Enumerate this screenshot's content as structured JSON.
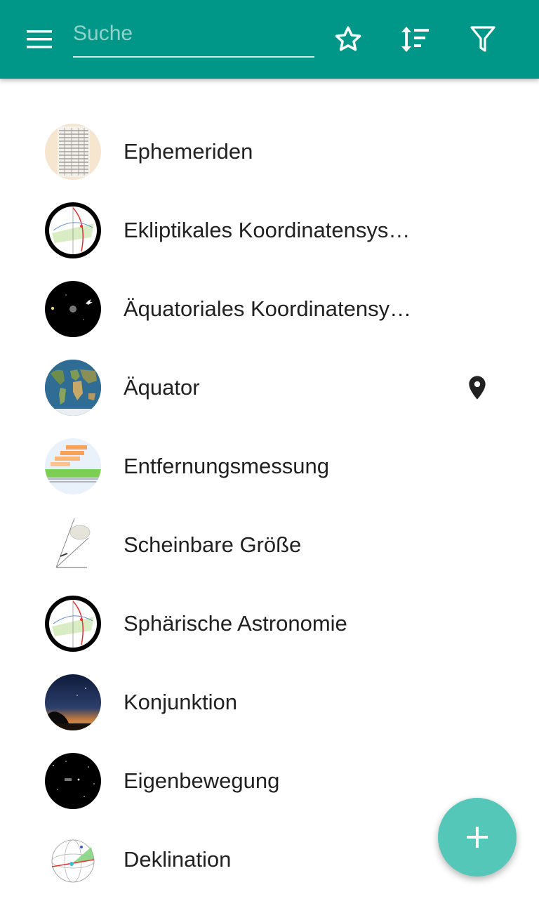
{
  "toolbar": {
    "search_placeholder": "Suche",
    "search_value": "",
    "icons": [
      "menu-icon",
      "star-outline-icon",
      "sort-icon",
      "filter-icon"
    ],
    "color": "#009688"
  },
  "items": [
    {
      "label": "Ephemeriden",
      "thumb": "ephemeris-table-thumbnail"
    },
    {
      "label": "Ekliptikales Koordinatensys…",
      "thumb": "celestial-sphere-thumbnail"
    },
    {
      "label": "Äquatoriales Koordinatensy…",
      "thumb": "night-sky-thumbnail"
    },
    {
      "label": "Äquator",
      "thumb": "world-map-thumbnail",
      "pinned": true
    },
    {
      "label": "Entfernungsmessung",
      "thumb": "distance-ladder-thumbnail"
    },
    {
      "label": "Scheinbare Größe",
      "thumb": "apparent-size-thumbnail"
    },
    {
      "label": "Sphärische Astronomie",
      "thumb": "celestial-sphere-thumbnail"
    },
    {
      "label": "Konjunktion",
      "thumb": "twilight-sky-thumbnail"
    },
    {
      "label": "Eigenbewegung",
      "thumb": "star-field-thumbnail"
    },
    {
      "label": "Deklination",
      "thumb": "declination-sphere-thumbnail"
    }
  ],
  "fab": {
    "icon": "plus-icon",
    "color": "#55c7b8"
  }
}
